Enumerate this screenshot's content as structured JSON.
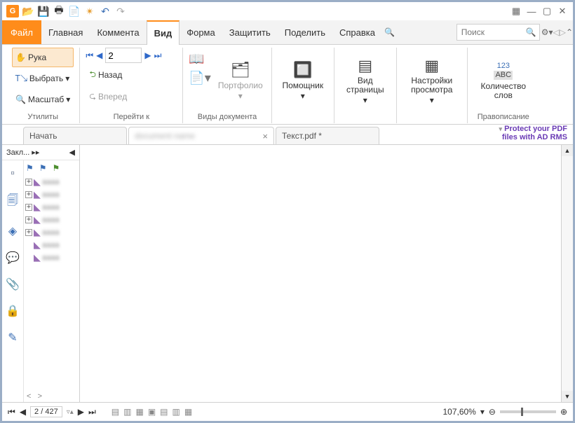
{
  "menu": {
    "file": "Файл",
    "home": "Главная",
    "comment": "Коммента",
    "view": "Вид",
    "form": "Форма",
    "protect": "Защитить",
    "share": "Поделить",
    "help": "Справка"
  },
  "search_placeholder": "Поиск",
  "ribbon": {
    "utils": {
      "hand": "Рука",
      "select": "Выбрать",
      "zoom": "Масштаб",
      "label": "Утилиты"
    },
    "goto": {
      "label": "Перейти к",
      "page": "2",
      "back": "Назад",
      "forward": "Вперед"
    },
    "doctypes": {
      "label": "Виды документа",
      "portfolio": "Портфолио"
    },
    "helper": {
      "label": "Помощник"
    },
    "pageview": {
      "label": "Вид страницы"
    },
    "viewset": {
      "label": "Настройки просмотра"
    },
    "wordcount": {
      "head": "123",
      "abc": "ABC",
      "label": "Количество слов",
      "group": "Правописание"
    }
  },
  "tabs": {
    "start": "Начать",
    "blank": "",
    "text": "Текст.pdf *"
  },
  "protect_banner": {
    "line1": "Protect your PDF",
    "line2": "files with AD RMS"
  },
  "sidepanel": {
    "title": "Закл...",
    "items": [
      "",
      "",
      "",
      "",
      "",
      "",
      ""
    ]
  },
  "status": {
    "page": "2 / 427",
    "zoom": "107,60%"
  }
}
